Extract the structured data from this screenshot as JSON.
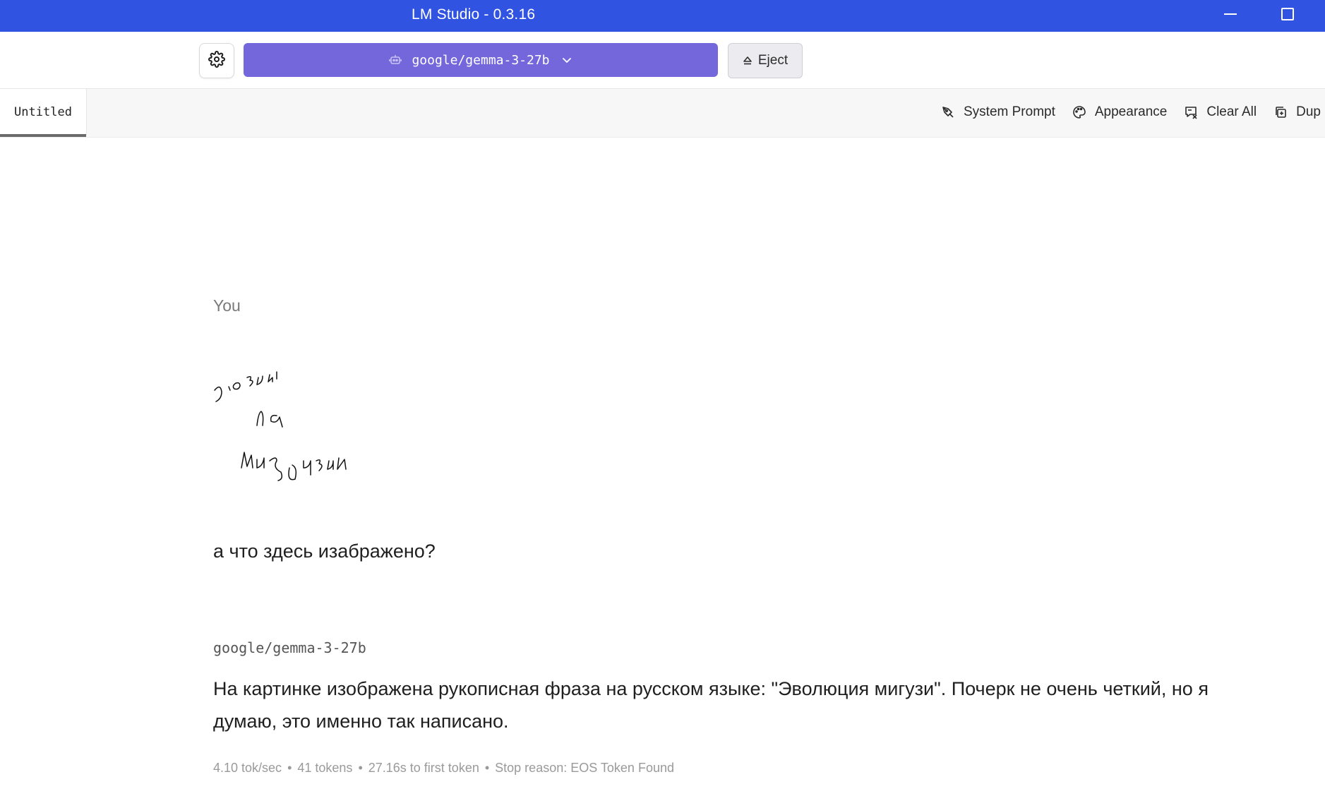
{
  "window": {
    "title": "LM Studio - 0.3.16",
    "controls": [
      "minimize",
      "maximize"
    ]
  },
  "toolbar": {
    "settings_icon": "gear-icon",
    "model_label": "google/gemma-3-27b",
    "model_icon": "robot-icon",
    "eject_label": "Eject",
    "accent_color": "#7367db"
  },
  "tabs": {
    "active_label": "Untitled",
    "actions": [
      {
        "label": "System Prompt",
        "icon": "pen-icon"
      },
      {
        "label": "Appearance",
        "icon": "palette-icon"
      },
      {
        "label": "Clear All",
        "icon": "clear-chat-icon"
      },
      {
        "label": "Dup",
        "icon": "duplicate-icon"
      }
    ]
  },
  "chat": {
    "user": {
      "sender": "You",
      "image_lines": [
        "эволюция",
        "мигузи"
      ],
      "text": "а что здесь изабражено?"
    },
    "assistant": {
      "sender": "google/gemma-3-27b",
      "text": "На картинке изображена рукописная фраза на русском языке: \"Эволюция мигузи\".  Почерк не очень четкий, но я думаю, это именно так написано.",
      "stats": {
        "speed": "4.10 tok/sec",
        "tokens": "41 tokens",
        "first_token": "27.16s to first token",
        "stop_reason": "Stop reason: EOS Token Found"
      }
    }
  },
  "colors": {
    "titlebar": "#3053e2",
    "muted_text": "#9a9a9a"
  }
}
